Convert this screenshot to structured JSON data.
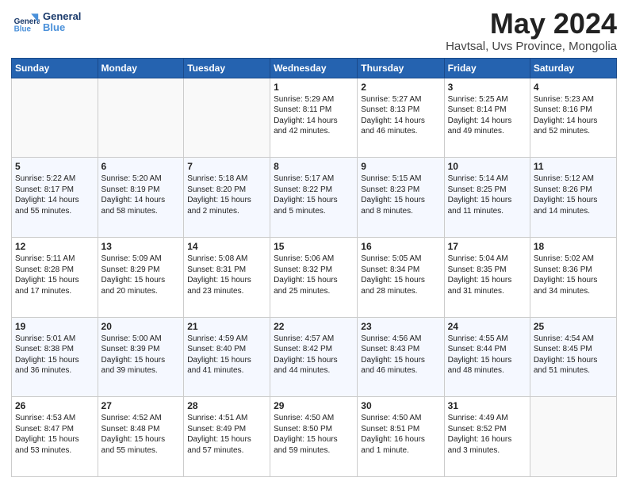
{
  "header": {
    "logo_line1": "General",
    "logo_line2": "Blue",
    "title": "May 2024",
    "subtitle": "Havtsal, Uvs Province, Mongolia"
  },
  "weekdays": [
    "Sunday",
    "Monday",
    "Tuesday",
    "Wednesday",
    "Thursday",
    "Friday",
    "Saturday"
  ],
  "weeks": [
    [
      {
        "day": "",
        "info": ""
      },
      {
        "day": "",
        "info": ""
      },
      {
        "day": "",
        "info": ""
      },
      {
        "day": "1",
        "info": "Sunrise: 5:29 AM\nSunset: 8:11 PM\nDaylight: 14 hours\nand 42 minutes."
      },
      {
        "day": "2",
        "info": "Sunrise: 5:27 AM\nSunset: 8:13 PM\nDaylight: 14 hours\nand 46 minutes."
      },
      {
        "day": "3",
        "info": "Sunrise: 5:25 AM\nSunset: 8:14 PM\nDaylight: 14 hours\nand 49 minutes."
      },
      {
        "day": "4",
        "info": "Sunrise: 5:23 AM\nSunset: 8:16 PM\nDaylight: 14 hours\nand 52 minutes."
      }
    ],
    [
      {
        "day": "5",
        "info": "Sunrise: 5:22 AM\nSunset: 8:17 PM\nDaylight: 14 hours\nand 55 minutes."
      },
      {
        "day": "6",
        "info": "Sunrise: 5:20 AM\nSunset: 8:19 PM\nDaylight: 14 hours\nand 58 minutes."
      },
      {
        "day": "7",
        "info": "Sunrise: 5:18 AM\nSunset: 8:20 PM\nDaylight: 15 hours\nand 2 minutes."
      },
      {
        "day": "8",
        "info": "Sunrise: 5:17 AM\nSunset: 8:22 PM\nDaylight: 15 hours\nand 5 minutes."
      },
      {
        "day": "9",
        "info": "Sunrise: 5:15 AM\nSunset: 8:23 PM\nDaylight: 15 hours\nand 8 minutes."
      },
      {
        "day": "10",
        "info": "Sunrise: 5:14 AM\nSunset: 8:25 PM\nDaylight: 15 hours\nand 11 minutes."
      },
      {
        "day": "11",
        "info": "Sunrise: 5:12 AM\nSunset: 8:26 PM\nDaylight: 15 hours\nand 14 minutes."
      }
    ],
    [
      {
        "day": "12",
        "info": "Sunrise: 5:11 AM\nSunset: 8:28 PM\nDaylight: 15 hours\nand 17 minutes."
      },
      {
        "day": "13",
        "info": "Sunrise: 5:09 AM\nSunset: 8:29 PM\nDaylight: 15 hours\nand 20 minutes."
      },
      {
        "day": "14",
        "info": "Sunrise: 5:08 AM\nSunset: 8:31 PM\nDaylight: 15 hours\nand 23 minutes."
      },
      {
        "day": "15",
        "info": "Sunrise: 5:06 AM\nSunset: 8:32 PM\nDaylight: 15 hours\nand 25 minutes."
      },
      {
        "day": "16",
        "info": "Sunrise: 5:05 AM\nSunset: 8:34 PM\nDaylight: 15 hours\nand 28 minutes."
      },
      {
        "day": "17",
        "info": "Sunrise: 5:04 AM\nSunset: 8:35 PM\nDaylight: 15 hours\nand 31 minutes."
      },
      {
        "day": "18",
        "info": "Sunrise: 5:02 AM\nSunset: 8:36 PM\nDaylight: 15 hours\nand 34 minutes."
      }
    ],
    [
      {
        "day": "19",
        "info": "Sunrise: 5:01 AM\nSunset: 8:38 PM\nDaylight: 15 hours\nand 36 minutes."
      },
      {
        "day": "20",
        "info": "Sunrise: 5:00 AM\nSunset: 8:39 PM\nDaylight: 15 hours\nand 39 minutes."
      },
      {
        "day": "21",
        "info": "Sunrise: 4:59 AM\nSunset: 8:40 PM\nDaylight: 15 hours\nand 41 minutes."
      },
      {
        "day": "22",
        "info": "Sunrise: 4:57 AM\nSunset: 8:42 PM\nDaylight: 15 hours\nand 44 minutes."
      },
      {
        "day": "23",
        "info": "Sunrise: 4:56 AM\nSunset: 8:43 PM\nDaylight: 15 hours\nand 46 minutes."
      },
      {
        "day": "24",
        "info": "Sunrise: 4:55 AM\nSunset: 8:44 PM\nDaylight: 15 hours\nand 48 minutes."
      },
      {
        "day": "25",
        "info": "Sunrise: 4:54 AM\nSunset: 8:45 PM\nDaylight: 15 hours\nand 51 minutes."
      }
    ],
    [
      {
        "day": "26",
        "info": "Sunrise: 4:53 AM\nSunset: 8:47 PM\nDaylight: 15 hours\nand 53 minutes."
      },
      {
        "day": "27",
        "info": "Sunrise: 4:52 AM\nSunset: 8:48 PM\nDaylight: 15 hours\nand 55 minutes."
      },
      {
        "day": "28",
        "info": "Sunrise: 4:51 AM\nSunset: 8:49 PM\nDaylight: 15 hours\nand 57 minutes."
      },
      {
        "day": "29",
        "info": "Sunrise: 4:50 AM\nSunset: 8:50 PM\nDaylight: 15 hours\nand 59 minutes."
      },
      {
        "day": "30",
        "info": "Sunrise: 4:50 AM\nSunset: 8:51 PM\nDaylight: 16 hours\nand 1 minute."
      },
      {
        "day": "31",
        "info": "Sunrise: 4:49 AM\nSunset: 8:52 PM\nDaylight: 16 hours\nand 3 minutes."
      },
      {
        "day": "",
        "info": ""
      }
    ]
  ]
}
